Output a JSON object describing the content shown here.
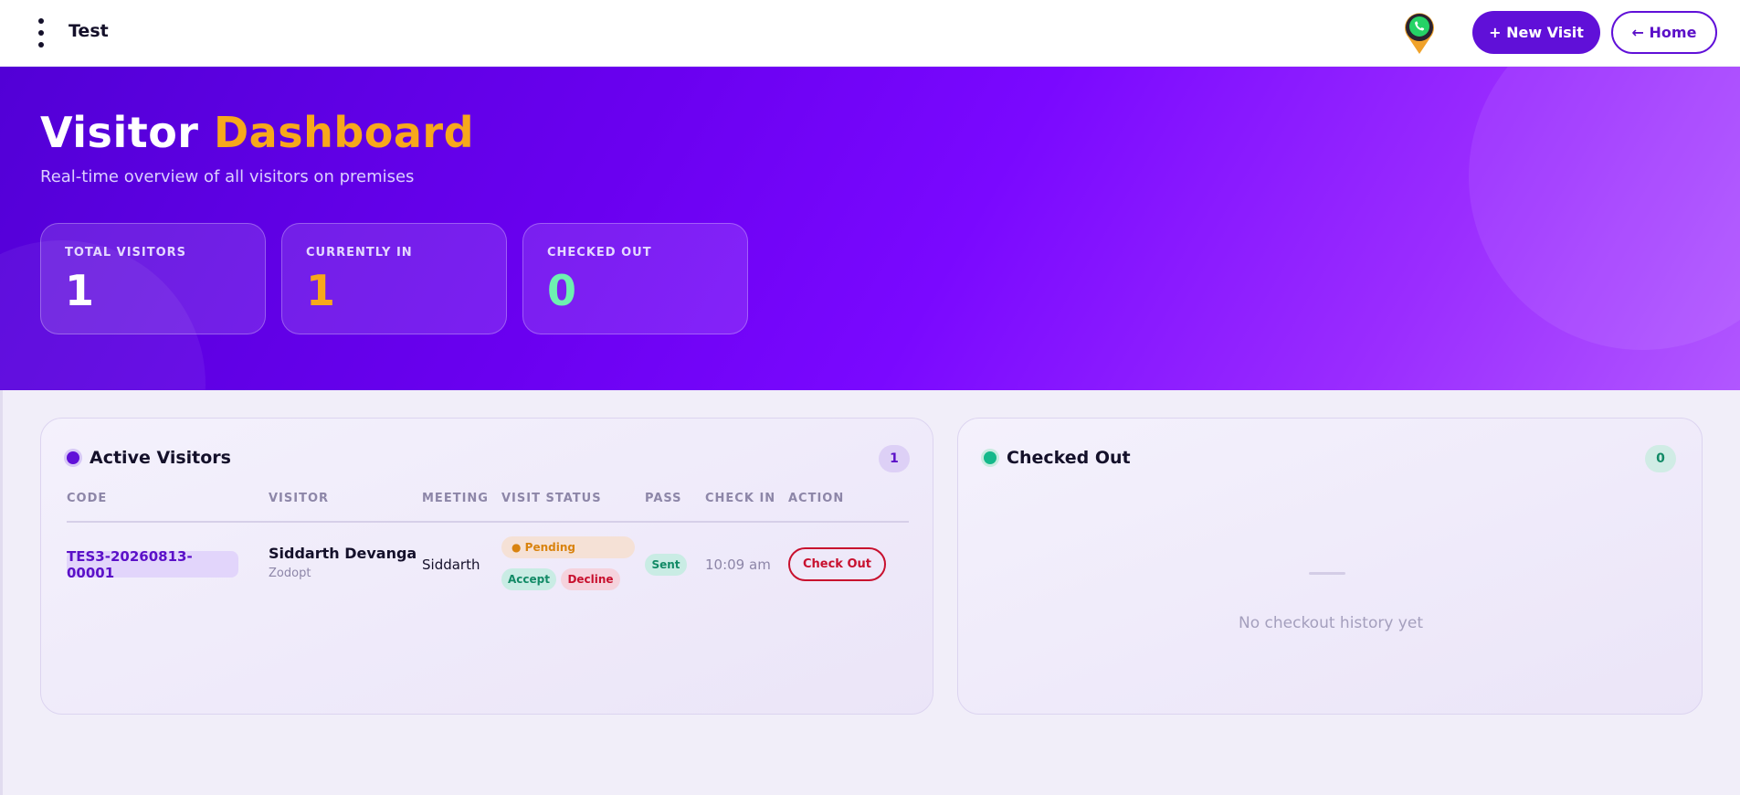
{
  "header": {
    "title": "Test",
    "menu_icon": "more-vertical-icon",
    "whatsapp_icon": "whatsapp-pin-icon",
    "new_visit_label": "+ New Visit",
    "home_label": "← Home"
  },
  "hero": {
    "title_main": "Visitor",
    "title_accent": "Dashboard",
    "subtitle": "Real-time overview of all visitors on premises",
    "accent_color": "#f7a81b"
  },
  "stats": [
    {
      "label": "TOTAL VISITORS",
      "value": "1",
      "color": "#ffffff"
    },
    {
      "label": "CURRENTLY IN",
      "value": "1",
      "color": "#f7a81b"
    },
    {
      "label": "CHECKED OUT",
      "value": "0",
      "color": "#6ef0b0"
    }
  ],
  "active": {
    "title": "Active Visitors",
    "count": "1",
    "dot_color": "#6010d8",
    "columns": [
      "CODE",
      "VISITOR",
      "MEETING",
      "VISIT STATUS",
      "PASS",
      "CHECK IN",
      "ACTION"
    ],
    "rows": [
      {
        "code": "TES3-20260813-00001",
        "visitor_name": "Siddarth Devanga",
        "visitor_company": "Zodopt",
        "meeting": "Siddarth",
        "status": "● Pending",
        "accept_label": "Accept",
        "decline_label": "Decline",
        "pass": "Sent",
        "check_in": "10:09 am",
        "action_label": "Check Out"
      }
    ]
  },
  "checked_out": {
    "title": "Checked Out",
    "count": "0",
    "dot_color": "#14b88a",
    "empty_text": "No checkout history yet"
  }
}
